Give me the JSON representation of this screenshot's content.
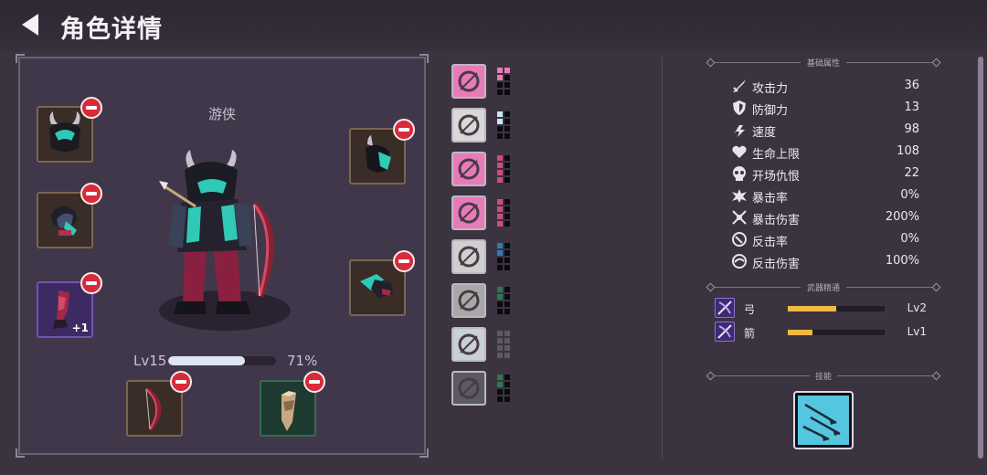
{
  "header": {
    "title": "角色详情",
    "back_icon": "back-arrow-icon"
  },
  "character": {
    "class_name": "游侠",
    "level_label": "Lv15",
    "xp_fraction": 0.71,
    "xp_percent_label": "71%"
  },
  "equipment": {
    "helmet_badge": "+1"
  },
  "runes": [
    {
      "icon": "boot-icon",
      "pip_color": "#e87ab8",
      "filled": [
        1,
        1,
        1,
        1,
        1,
        1,
        0,
        1
      ]
    },
    {
      "icon": "armor-figure-icon",
      "pip_color": "#c8e6ff",
      "filled": [
        1,
        0,
        1,
        0,
        1,
        1,
        1,
        1
      ]
    },
    {
      "icon": "claw-slash-icon",
      "pip_color": "#d24a82",
      "filled": [
        1,
        1,
        1,
        1,
        1,
        1,
        1,
        1
      ]
    },
    {
      "icon": "crossed-slash-icon",
      "pip_color": "#d24a82",
      "filled": [
        1,
        0,
        1,
        1,
        1,
        1,
        1,
        1
      ]
    },
    {
      "icon": "heart-icon",
      "pip_color": "#2c7ab8",
      "filled": [
        1,
        0,
        1,
        1,
        1,
        1,
        1,
        1
      ]
    },
    {
      "icon": "fountain-icon",
      "pip_color": "#2a7a50",
      "filled": [
        1,
        0,
        1,
        1,
        1,
        1,
        1,
        1
      ]
    },
    {
      "icon": "potion-splash-icon",
      "pip_color": "#5a5a62",
      "filled": [
        1,
        1,
        1,
        1,
        1,
        1,
        1,
        1
      ]
    },
    {
      "icon": "cave-icon",
      "pip_color": "#2a7a50",
      "filled": [
        1,
        0,
        1,
        1,
        1,
        1,
        1,
        1
      ]
    }
  ],
  "stats_section": {
    "title": "基础属性",
    "rows": [
      {
        "icon": "sword-icon",
        "label": "攻击力",
        "value": "36"
      },
      {
        "icon": "shield-icon",
        "label": "防御力",
        "value": "13"
      },
      {
        "icon": "speed-icon",
        "label": "速度",
        "value": "98"
      },
      {
        "icon": "heart-icon",
        "label": "生命上限",
        "value": "108"
      },
      {
        "icon": "skull-icon",
        "label": "开场仇恨",
        "value": "22"
      },
      {
        "icon": "crit-burst-icon",
        "label": "暴击率",
        "value": "0%"
      },
      {
        "icon": "crit-damage-icon",
        "label": "暴击伤害",
        "value": "200%"
      },
      {
        "icon": "counter-icon",
        "label": "反击率",
        "value": "0%"
      },
      {
        "icon": "counter-damage-icon",
        "label": "反击伤害",
        "value": "100%"
      }
    ]
  },
  "weapon_mastery": {
    "title": "武器精通",
    "rows": [
      {
        "icon": "bow-icon",
        "label": "弓",
        "level": "Lv2",
        "progress": 0.5
      },
      {
        "icon": "arrow-icon",
        "label": "箭",
        "level": "Lv1",
        "progress": 0.25
      }
    ]
  },
  "skills": {
    "title": "技能",
    "icon": "arrow-volley-icon"
  },
  "colors": {
    "background": "#3b3440",
    "remove_badge": "#d82a3a",
    "mastery_bar": "#f2b844",
    "xp_bar": "#dfe4f6"
  }
}
